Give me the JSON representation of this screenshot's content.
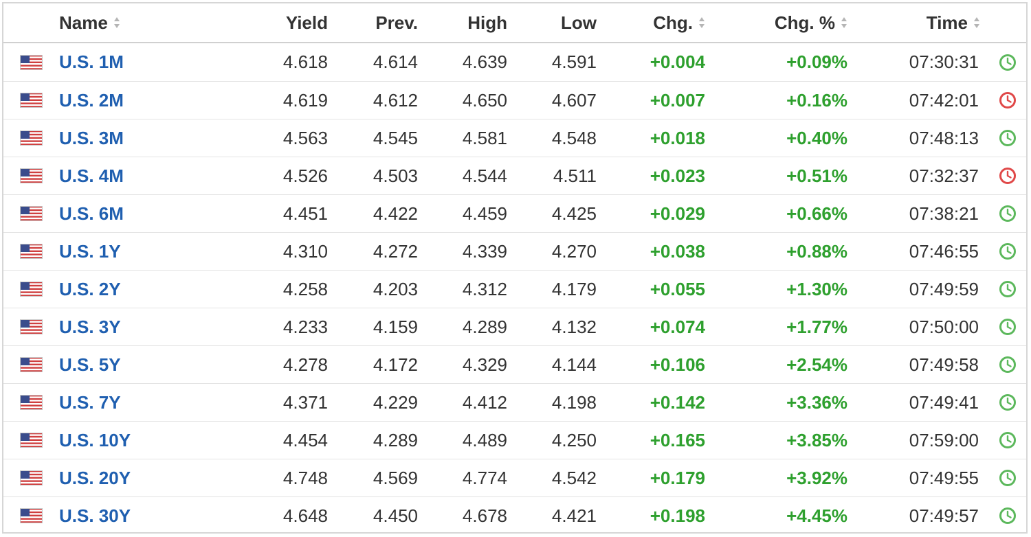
{
  "columns": {
    "name": "Name",
    "yield": "Yield",
    "prev": "Prev.",
    "high": "High",
    "low": "Low",
    "chg": "Chg.",
    "chg_pct": "Chg. %",
    "time": "Time"
  },
  "colors": {
    "link": "#1f5fb0",
    "positive": "#2ea02e",
    "clock_open": "#5cb85c",
    "clock_closed": "#e04848"
  },
  "rows": [
    {
      "name": "U.S. 1M",
      "yield": "4.618",
      "prev": "4.614",
      "high": "4.639",
      "low": "4.591",
      "chg": "+0.004",
      "chg_pct": "+0.09%",
      "time": "07:30:31",
      "clock": "green-clock-icon"
    },
    {
      "name": "U.S. 2M",
      "yield": "4.619",
      "prev": "4.612",
      "high": "4.650",
      "low": "4.607",
      "chg": "+0.007",
      "chg_pct": "+0.16%",
      "time": "07:42:01",
      "clock": "red-clock-icon"
    },
    {
      "name": "U.S. 3M",
      "yield": "4.563",
      "prev": "4.545",
      "high": "4.581",
      "low": "4.548",
      "chg": "+0.018",
      "chg_pct": "+0.40%",
      "time": "07:48:13",
      "clock": "green-clock-icon"
    },
    {
      "name": "U.S. 4M",
      "yield": "4.526",
      "prev": "4.503",
      "high": "4.544",
      "low": "4.511",
      "chg": "+0.023",
      "chg_pct": "+0.51%",
      "time": "07:32:37",
      "clock": "red-clock-icon"
    },
    {
      "name": "U.S. 6M",
      "yield": "4.451",
      "prev": "4.422",
      "high": "4.459",
      "low": "4.425",
      "chg": "+0.029",
      "chg_pct": "+0.66%",
      "time": "07:38:21",
      "clock": "green-clock-icon"
    },
    {
      "name": "U.S. 1Y",
      "yield": "4.310",
      "prev": "4.272",
      "high": "4.339",
      "low": "4.270",
      "chg": "+0.038",
      "chg_pct": "+0.88%",
      "time": "07:46:55",
      "clock": "green-clock-icon"
    },
    {
      "name": "U.S. 2Y",
      "yield": "4.258",
      "prev": "4.203",
      "high": "4.312",
      "low": "4.179",
      "chg": "+0.055",
      "chg_pct": "+1.30%",
      "time": "07:49:59",
      "clock": "green-clock-icon"
    },
    {
      "name": "U.S. 3Y",
      "yield": "4.233",
      "prev": "4.159",
      "high": "4.289",
      "low": "4.132",
      "chg": "+0.074",
      "chg_pct": "+1.77%",
      "time": "07:50:00",
      "clock": "green-clock-icon"
    },
    {
      "name": "U.S. 5Y",
      "yield": "4.278",
      "prev": "4.172",
      "high": "4.329",
      "low": "4.144",
      "chg": "+0.106",
      "chg_pct": "+2.54%",
      "time": "07:49:58",
      "clock": "green-clock-icon"
    },
    {
      "name": "U.S. 7Y",
      "yield": "4.371",
      "prev": "4.229",
      "high": "4.412",
      "low": "4.198",
      "chg": "+0.142",
      "chg_pct": "+3.36%",
      "time": "07:49:41",
      "clock": "green-clock-icon"
    },
    {
      "name": "U.S. 10Y",
      "yield": "4.454",
      "prev": "4.289",
      "high": "4.489",
      "low": "4.250",
      "chg": "+0.165",
      "chg_pct": "+3.85%",
      "time": "07:59:00",
      "clock": "green-clock-icon"
    },
    {
      "name": "U.S. 20Y",
      "yield": "4.748",
      "prev": "4.569",
      "high": "4.774",
      "low": "4.542",
      "chg": "+0.179",
      "chg_pct": "+3.92%",
      "time": "07:49:55",
      "clock": "green-clock-icon"
    },
    {
      "name": "U.S. 30Y",
      "yield": "4.648",
      "prev": "4.450",
      "high": "4.678",
      "low": "4.421",
      "chg": "+0.198",
      "chg_pct": "+4.45%",
      "time": "07:49:57",
      "clock": "green-clock-icon"
    }
  ]
}
